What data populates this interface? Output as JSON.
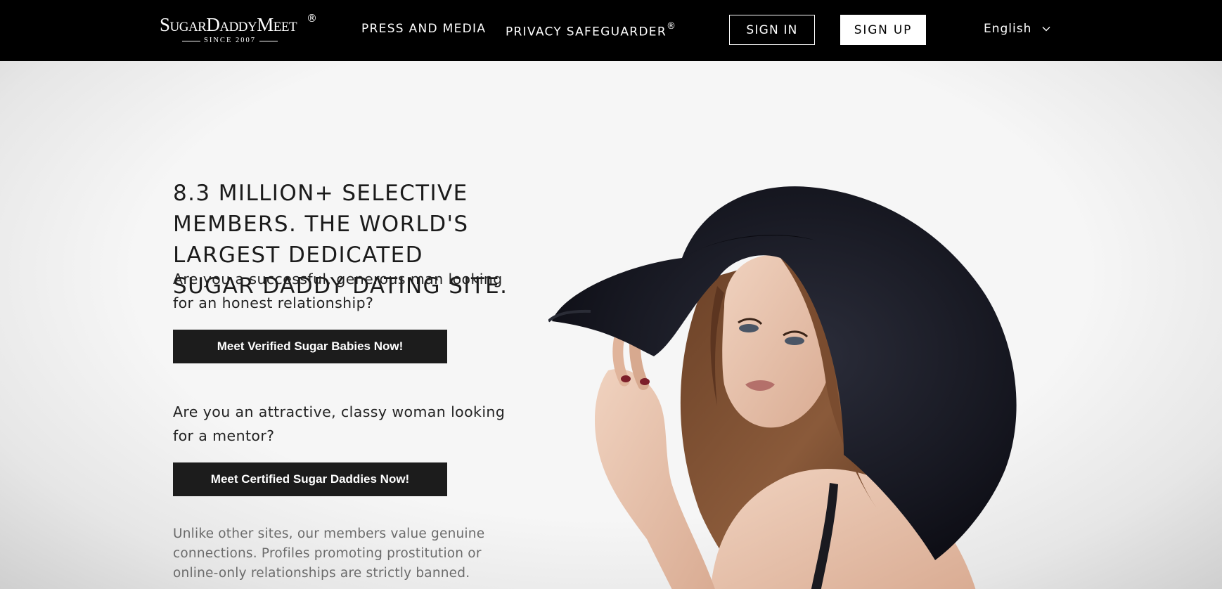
{
  "nav": {
    "logo": {
      "name": "SugarDaddyMeet",
      "reg": "®",
      "since": "SINCE 2007"
    },
    "links": [
      {
        "label": "PRESS AND MEDIA"
      },
      {
        "label": "PRIVACY SAFEGUARDER",
        "reg": "®"
      }
    ],
    "sign_in": "SIGN IN",
    "sign_up": "SIGN UP",
    "language": "English"
  },
  "hero": {
    "headline": "8.3 MILLION+ SELECTIVE MEMBERS. THE WORLD'S LARGEST DEDICATED SUGAR DADDY DATING SITE.",
    "question_men": "Are you a successful, generous man looking for an honest relationship?",
    "cta_men": "Meet Verified Sugar Babies Now!",
    "question_women": "Are you an attractive, classy woman looking for a mentor?",
    "cta_women": "Meet Certified Sugar Daddies Now!",
    "disclaimer": "Unlike other sites, our members value genuine connections. Profiles promoting prostitution or online-only relationships are strictly banned."
  },
  "colors": {
    "nav_bg": "#000000",
    "cta_bg": "#1c1c1c",
    "hero_bg": "#f4f4f4"
  }
}
